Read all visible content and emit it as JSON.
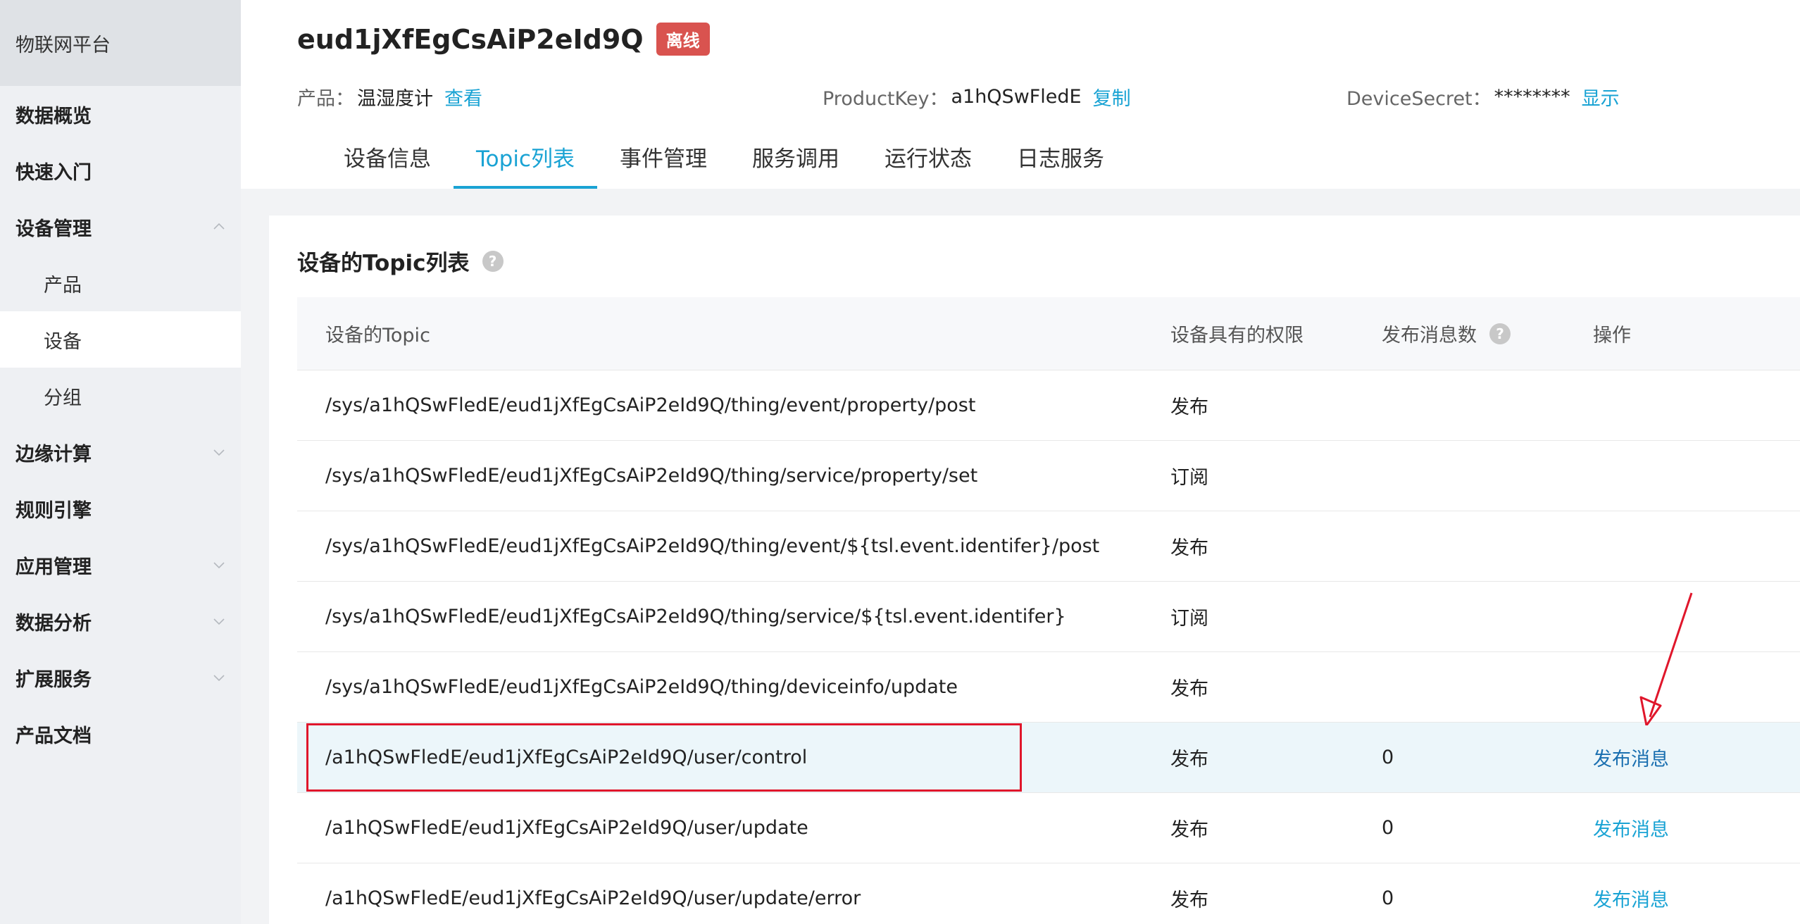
{
  "sidebar": {
    "brand": "物联网平台",
    "items": [
      {
        "label": "数据概览"
      },
      {
        "label": "快速入门"
      },
      {
        "label": "设备管理"
      },
      {
        "label": "产品"
      },
      {
        "label": "设备"
      },
      {
        "label": "分组"
      },
      {
        "label": "边缘计算"
      },
      {
        "label": "规则引擎"
      },
      {
        "label": "应用管理"
      },
      {
        "label": "数据分析"
      },
      {
        "label": "扩展服务"
      },
      {
        "label": "产品文档"
      }
    ]
  },
  "header": {
    "device_name": "eud1jXfEgCsAiP2eId9Q",
    "status_badge": "离线",
    "product_label": "产品：",
    "product_value": "温湿度计",
    "product_link": "查看",
    "productkey_label": "ProductKey：",
    "productkey_value": "a1hQSwFledE",
    "productkey_link": "复制",
    "secret_label": "DeviceSecret：",
    "secret_value": "********",
    "secret_link": "显示",
    "tabs": [
      {
        "label": "设备信息"
      },
      {
        "label": "Topic列表"
      },
      {
        "label": "事件管理"
      },
      {
        "label": "服务调用"
      },
      {
        "label": "运行状态"
      },
      {
        "label": "日志服务"
      }
    ]
  },
  "main": {
    "title": "设备的Topic列表",
    "help_glyph": "?",
    "columns": [
      "设备的Topic",
      "设备具有的权限",
      "发布消息数",
      "操作"
    ],
    "rows": [
      {
        "topic": "/sys/a1hQSwFledE/eud1jXfEgCsAiP2eId9Q/thing/event/property/post",
        "perm": "发布",
        "count": "",
        "op": ""
      },
      {
        "topic": "/sys/a1hQSwFledE/eud1jXfEgCsAiP2eId9Q/thing/service/property/set",
        "perm": "订阅",
        "count": "",
        "op": ""
      },
      {
        "topic": "/sys/a1hQSwFledE/eud1jXfEgCsAiP2eId9Q/thing/event/${tsl.event.identifer}/post",
        "perm": "发布",
        "count": "",
        "op": ""
      },
      {
        "topic": "/sys/a1hQSwFledE/eud1jXfEgCsAiP2eId9Q/thing/service/${tsl.event.identifer}",
        "perm": "订阅",
        "count": "",
        "op": ""
      },
      {
        "topic": "/sys/a1hQSwFledE/eud1jXfEgCsAiP2eId9Q/thing/deviceinfo/update",
        "perm": "发布",
        "count": "",
        "op": ""
      },
      {
        "topic": "/a1hQSwFledE/eud1jXfEgCsAiP2eId9Q/user/control",
        "perm": "发布",
        "count": "0",
        "op": "发布消息"
      },
      {
        "topic": "/a1hQSwFledE/eud1jXfEgCsAiP2eId9Q/user/update",
        "perm": "发布",
        "count": "0",
        "op": "发布消息"
      },
      {
        "topic": "/a1hQSwFledE/eud1jXfEgCsAiP2eId9Q/user/update/error",
        "perm": "发布",
        "count": "0",
        "op": "发布消息"
      }
    ]
  },
  "colors": {
    "accent": "#1aa3d4",
    "badge": "#d9534f",
    "highlight": "#e0162b"
  }
}
